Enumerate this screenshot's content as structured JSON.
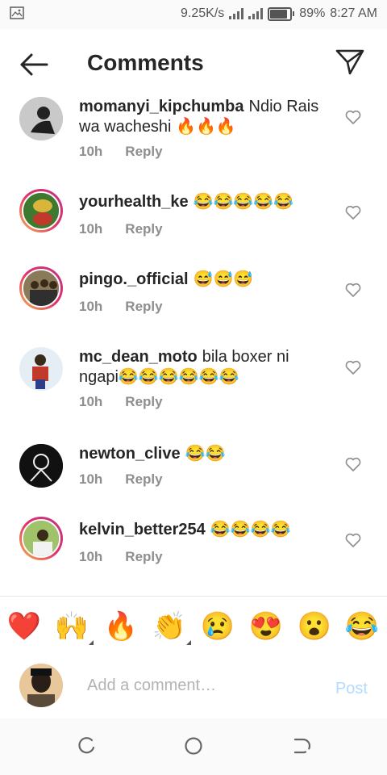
{
  "status": {
    "speed": "9.25K/s",
    "battery": "89%",
    "time": "8:27 AM"
  },
  "header": {
    "title": "Comments"
  },
  "comments": [
    {
      "user": "momanyi_kipchumba",
      "text": "Ndio Rais wa wacheshi 🔥🔥🔥",
      "time": "10h",
      "reply": "Reply"
    },
    {
      "user": "yourhealth_ke",
      "text": "😂😂😂😂😂",
      "time": "10h",
      "reply": "Reply"
    },
    {
      "user": "pingo._official",
      "text": "😅😅😅",
      "time": "10h",
      "reply": "Reply"
    },
    {
      "user": "mc_dean_moto",
      "text": "bila boxer ni ngapi😂😂😂😂😂😂",
      "time": "10h",
      "reply": "Reply"
    },
    {
      "user": "newton_clive",
      "text": "😂😂",
      "time": "10h",
      "reply": "Reply"
    },
    {
      "user": "kelvin_better254",
      "text": "😂😂😂😂",
      "time": "10h",
      "reply": "Reply"
    }
  ],
  "emoji_bar": [
    "❤️",
    "🙌",
    "🔥",
    "👏",
    "😢",
    "😍",
    "😮",
    "😂"
  ],
  "composer": {
    "placeholder": "Add a comment…",
    "post_label": "Post"
  }
}
